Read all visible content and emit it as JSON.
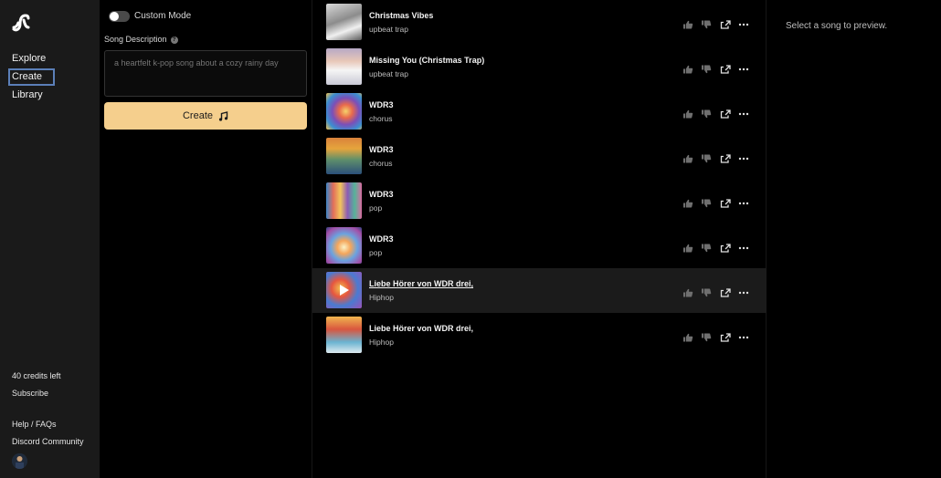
{
  "sidebar": {
    "nav": [
      {
        "label": "Explore"
      },
      {
        "label": "Create"
      },
      {
        "label": "Library"
      }
    ],
    "credits": "40 credits left",
    "subscribe": "Subscribe",
    "help": "Help / FAQs",
    "discord": "Discord Community"
  },
  "create_panel": {
    "custom_mode_label": "Custom Mode",
    "song_description_label": "Song Description",
    "description_placeholder": "a heartfelt k-pop song about a cozy rainy day",
    "create_label": "Create"
  },
  "songs": [
    {
      "title": "Christmas Vibes",
      "tag": "upbeat trap"
    },
    {
      "title": "Missing You (Christmas Trap)",
      "tag": "upbeat trap"
    },
    {
      "title": "WDR3",
      "tag": "chorus"
    },
    {
      "title": "WDR3",
      "tag": "chorus"
    },
    {
      "title": "WDR3",
      "tag": "pop"
    },
    {
      "title": "WDR3",
      "tag": "pop"
    },
    {
      "title": "Liebe Hörer von WDR drei,",
      "tag": "Hiphop"
    },
    {
      "title": "Liebe Hörer von WDR drei,",
      "tag": "Hiphop"
    }
  ],
  "preview_text": "Select a song to preview.",
  "colors": {
    "accent_button": "#f5cf8d",
    "active_nav_border": "#5b7fb8",
    "sidebar_bg": "#1a1a1a"
  },
  "icons": [
    "logo-icon",
    "help-icon",
    "music-note-icon",
    "thumbs-up-icon",
    "thumbs-down-icon",
    "share-icon",
    "more-icon",
    "play-icon"
  ]
}
